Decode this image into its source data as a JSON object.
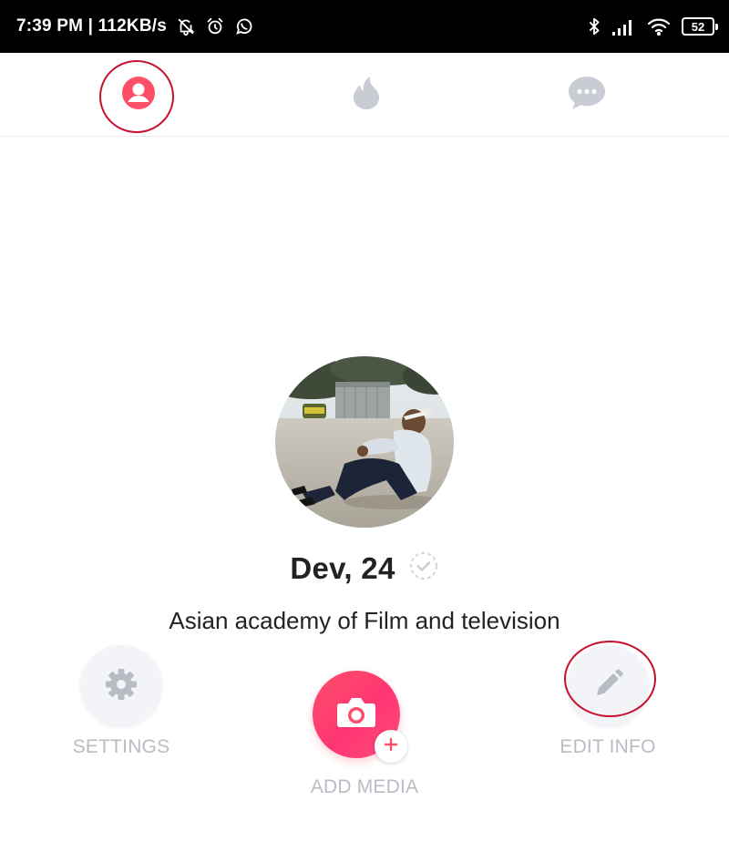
{
  "status_bar": {
    "time_speed": "7:39 PM | 112KB/s",
    "battery": "52",
    "left_icons": [
      "bell-off-icon",
      "alarm-icon",
      "whatsapp-icon"
    ],
    "right_icons": [
      "bluetooth-icon",
      "signal-icon",
      "wifi-icon",
      "battery-icon"
    ]
  },
  "top_nav": {
    "tabs": [
      {
        "icon": "profile-icon",
        "state": "active",
        "color": "#fd5068"
      },
      {
        "icon": "flame-icon",
        "state": "inactive",
        "color": "#c9ccd3"
      },
      {
        "icon": "chat-icon",
        "state": "inactive",
        "color": "#c9ccd3"
      }
    ]
  },
  "profile": {
    "name": "Dev, 24",
    "school": "Asian academy of Film and television"
  },
  "actions": {
    "settings_label": "SETTINGS",
    "add_media_label": "ADD MEDIA",
    "edit_info_label": "EDIT INFO"
  },
  "colors": {
    "accent": "#fd5068",
    "inactive_icon": "#c9ccd3",
    "annotation_ring": "#c8102e",
    "label_gray": "#b8bcc4"
  }
}
